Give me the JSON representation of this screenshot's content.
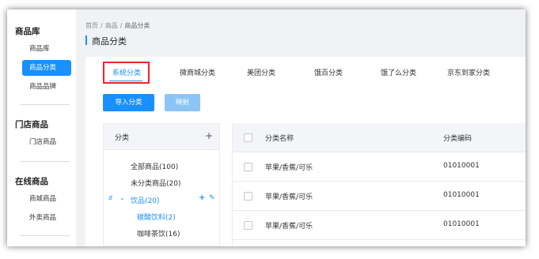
{
  "sidebar": {
    "groups": [
      {
        "title": "商品库",
        "items": [
          {
            "label": "商品库"
          },
          {
            "label": "商品分类",
            "active": true
          },
          {
            "label": "商品品牌"
          }
        ]
      },
      {
        "title": "门店商品",
        "items": [
          {
            "label": "门店商品"
          }
        ]
      },
      {
        "title": "在线商品",
        "items": [
          {
            "label": "商城商品"
          },
          {
            "label": "外卖商品"
          }
        ]
      }
    ]
  },
  "breadcrumb": [
    "首页",
    "商品",
    "商品分类"
  ],
  "page_title": "商品分类",
  "tabs": [
    {
      "label": "系统分类",
      "active": true
    },
    {
      "label": "微商城分类"
    },
    {
      "label": "美团分类"
    },
    {
      "label": "饿百分类"
    },
    {
      "label": "饿了么分类"
    },
    {
      "label": "京东到家分类"
    }
  ],
  "buttons": {
    "import": "导入分类",
    "map": "映射"
  },
  "tree": {
    "header": "分类",
    "add": "+",
    "nodes": [
      {
        "label": "全部商品(100)"
      },
      {
        "label": "未分类商品(20)"
      },
      {
        "label": "饮品(20)",
        "selected": true
      },
      {
        "label": "碳酸饮料(2)"
      },
      {
        "label": "咖啡茶饮(16)"
      }
    ]
  },
  "table": {
    "columns": [
      "分类名称",
      "分类编码"
    ],
    "rows": [
      [
        "苹果/香蕉/可乐",
        "01010001"
      ],
      [
        "苹果/香蕉/可乐",
        "01010001"
      ],
      [
        "苹果/香蕉/可乐",
        "01010001"
      ]
    ]
  },
  "colors": {
    "accent": "#1890ff",
    "highlight_outline": "#f5222d",
    "disabled": "#8cc5f5"
  }
}
